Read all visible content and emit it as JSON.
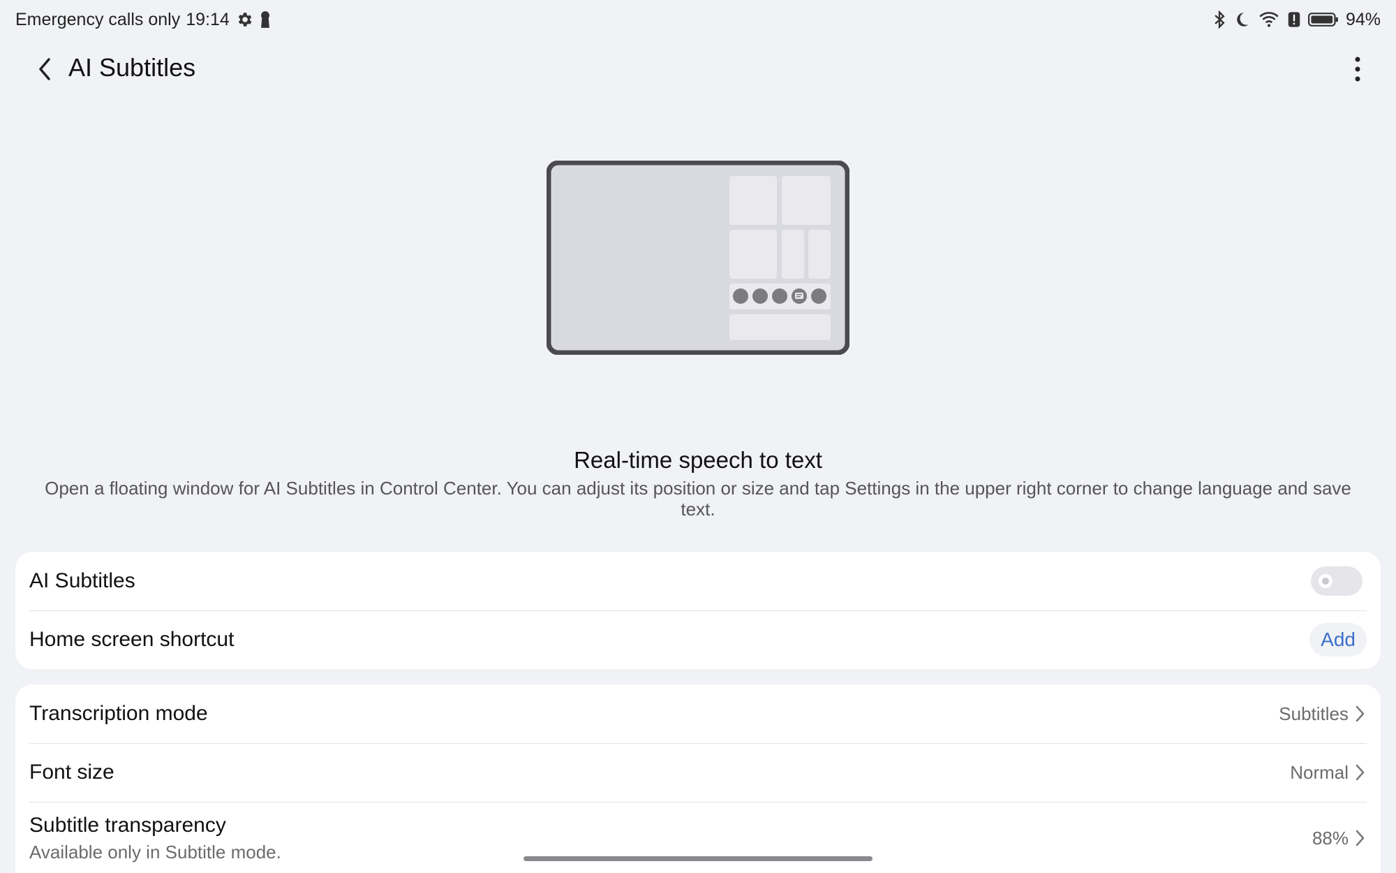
{
  "status_bar": {
    "carrier": "Emergency calls only",
    "time": "19:14",
    "battery": "94%"
  },
  "header": {
    "title": "AI Subtitles"
  },
  "intro": {
    "title": "Real-time speech to text",
    "description": "Open a floating window for AI Subtitles in Control Center. You can adjust its position or size and tap Settings in the upper right corner to change language and save text."
  },
  "card1": {
    "ai_subtitles_label": "AI Subtitles",
    "ai_subtitles_enabled": false,
    "home_shortcut_label": "Home screen shortcut",
    "add_label": "Add"
  },
  "card2": {
    "transcription_label": "Transcription mode",
    "transcription_value": "Subtitles",
    "font_size_label": "Font size",
    "font_size_value": "Normal",
    "transparency_label": "Subtitle transparency",
    "transparency_sub": "Available only in Subtitle mode.",
    "transparency_value": "88%"
  },
  "colors": {
    "background": "#f1f2f6",
    "card": "#ffffff",
    "accent": "#3b6fc9"
  }
}
